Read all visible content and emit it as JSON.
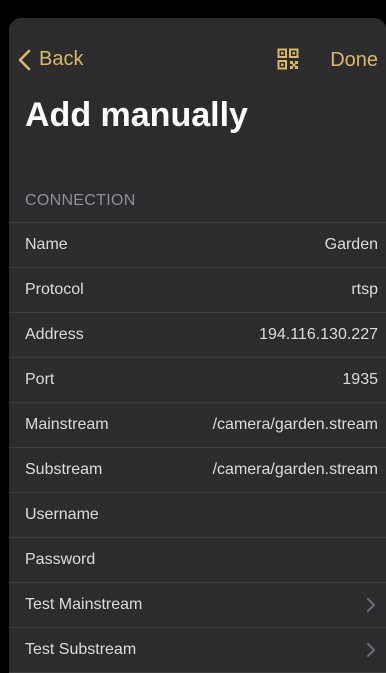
{
  "nav": {
    "back_label": "Back",
    "done_label": "Done",
    "qr_icon": "qr-code-icon"
  },
  "title": "Add manually",
  "section": {
    "header": "CONNECTION"
  },
  "rows": [
    {
      "label": "Name",
      "value": "Garden"
    },
    {
      "label": "Protocol",
      "value": "rtsp"
    },
    {
      "label": "Address",
      "value": "194.116.130.227"
    },
    {
      "label": "Port",
      "value": "1935"
    },
    {
      "label": "Mainstream",
      "value": "/camera/garden.stream"
    },
    {
      "label": "Substream",
      "value": "/camera/garden.stream"
    },
    {
      "label": "Username",
      "value": ""
    },
    {
      "label": "Password",
      "value": ""
    },
    {
      "label": "Test Mainstream",
      "value": ""
    },
    {
      "label": "Test Substream",
      "value": ""
    }
  ],
  "colors": {
    "accent": "#d9b86a",
    "background": "#2c2c2e",
    "separator": "#3e3e41",
    "secondary_text": "#8e8e93"
  }
}
